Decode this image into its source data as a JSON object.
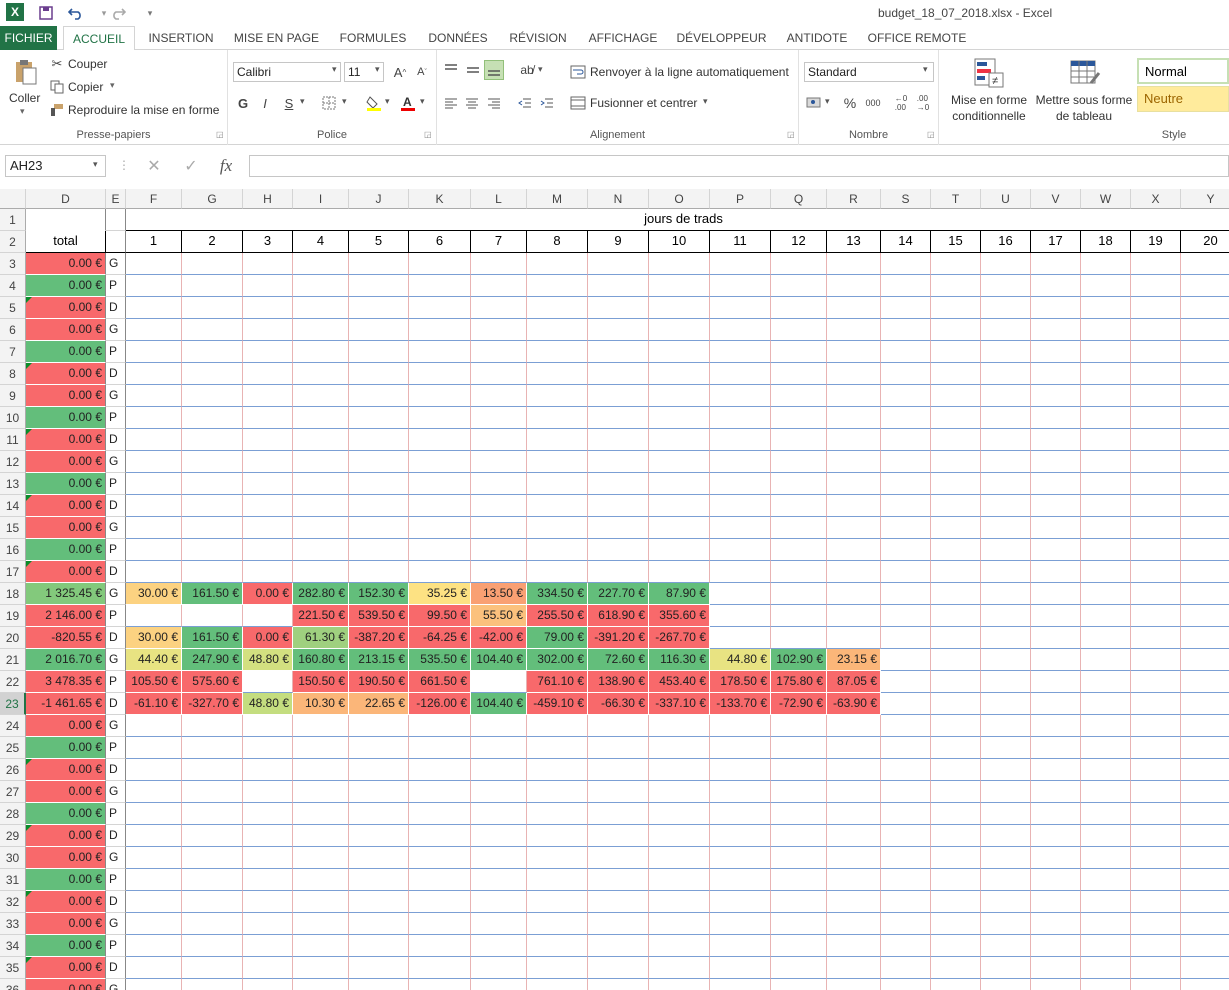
{
  "titlebar": {
    "title": "budget_18_07_2018.xlsx - Excel",
    "app_icon": "X",
    "save_icon": "save-icon",
    "undo_icon": "undo-icon",
    "redo_icon": "redo-icon"
  },
  "tabs": [
    "FICHIER",
    "ACCUEIL",
    "INSERTION",
    "MISE EN PAGE",
    "FORMULES",
    "DONNÉES",
    "RÉVISION",
    "AFFICHAGE",
    "DÉVELOPPEUR",
    "ANTIDOTE",
    "OFFICE REMOTE"
  ],
  "ribbon": {
    "clipboard": {
      "paste": "Coller",
      "cut": "Couper",
      "copy": "Copier",
      "format_painter": "Reproduire la mise en forme",
      "label": "Presse-papiers"
    },
    "font": {
      "name": "Calibri",
      "size": "11",
      "bold": "G",
      "italic": "I",
      "underline": "S",
      "label": "Police"
    },
    "alignment": {
      "wrap": "Renvoyer à la ligne automatiquement",
      "merge": "Fusionner et centrer",
      "label": "Alignement"
    },
    "number": {
      "format": "Standard",
      "percent": "%",
      "thousands": "000",
      "label": "Nombre"
    },
    "styles": {
      "conditional": "Mise en forme conditionnelle",
      "table": "Mettre sous forme de tableau",
      "normal": "Normal",
      "neutral": "Neutre",
      "label": "Style"
    }
  },
  "formula_bar": {
    "name_box": "AH23",
    "fx": "fx",
    "value": ""
  },
  "columns": [
    "D",
    "E",
    "F",
    "G",
    "H",
    "I",
    "J",
    "K",
    "L",
    "M",
    "N",
    "O",
    "P",
    "Q",
    "R",
    "S",
    "T",
    "U",
    "V",
    "W",
    "X",
    "Y"
  ],
  "header": {
    "group_title": "jours de trads",
    "total": "total",
    "days": [
      "1",
      "2",
      "3",
      "4",
      "5",
      "6",
      "7",
      "8",
      "9",
      "10",
      "11",
      "12",
      "13",
      "14",
      "15",
      "16",
      "17",
      "18",
      "19",
      "20"
    ]
  },
  "colors": {
    "red": "#f8696b",
    "green": "#63be7b",
    "accent": "#217346"
  },
  "rows": [
    {
      "n": "3",
      "total": "0.00 €",
      "tc": "red",
      "type": "G",
      "tri": false,
      "cells": []
    },
    {
      "n": "4",
      "total": "0.00 €",
      "tc": "green",
      "type": "P",
      "tri": false,
      "cells": []
    },
    {
      "n": "5",
      "total": "0.00 €",
      "tc": "red",
      "type": "D",
      "tri": true,
      "cells": []
    },
    {
      "n": "6",
      "total": "0.00 €",
      "tc": "red",
      "type": "G",
      "tri": false,
      "cells": []
    },
    {
      "n": "7",
      "total": "0.00 €",
      "tc": "green",
      "type": "P",
      "tri": false,
      "cells": []
    },
    {
      "n": "8",
      "total": "0.00 €",
      "tc": "red",
      "type": "D",
      "tri": true,
      "cells": []
    },
    {
      "n": "9",
      "total": "0.00 €",
      "tc": "red",
      "type": "G",
      "tri": false,
      "cells": []
    },
    {
      "n": "10",
      "total": "0.00 €",
      "tc": "green",
      "type": "P",
      "tri": false,
      "cells": []
    },
    {
      "n": "11",
      "total": "0.00 €",
      "tc": "red",
      "type": "D",
      "tri": true,
      "cells": []
    },
    {
      "n": "12",
      "total": "0.00 €",
      "tc": "red",
      "type": "G",
      "tri": false,
      "cells": []
    },
    {
      "n": "13",
      "total": "0.00 €",
      "tc": "green",
      "type": "P",
      "tri": false,
      "cells": []
    },
    {
      "n": "14",
      "total": "0.00 €",
      "tc": "red",
      "type": "D",
      "tri": true,
      "cells": []
    },
    {
      "n": "15",
      "total": "0.00 €",
      "tc": "red",
      "type": "G",
      "tri": false,
      "cells": []
    },
    {
      "n": "16",
      "total": "0.00 €",
      "tc": "green",
      "type": "P",
      "tri": false,
      "cells": []
    },
    {
      "n": "17",
      "total": "0.00 €",
      "tc": "red",
      "type": "D",
      "tri": true,
      "cells": []
    },
    {
      "n": "18",
      "total": "1 325.45 €",
      "tc": "#83c97c",
      "type": "G",
      "tri": false,
      "cells": [
        [
          "30.00 €",
          "#fcd281"
        ],
        [
          "161.50 €",
          "#63be7b"
        ],
        [
          "0.00 €",
          "#f8696b"
        ],
        [
          "282.80 €",
          "#63be7b"
        ],
        [
          "152.30 €",
          "#63be7b"
        ],
        [
          "35.25 €",
          "#fde283"
        ],
        [
          "13.50 €",
          "#f9a073"
        ],
        [
          "334.50 €",
          "#63be7b"
        ],
        [
          "227.70 €",
          "#63be7b"
        ],
        [
          "87.90 €",
          "#63be7b"
        ]
      ]
    },
    {
      "n": "19",
      "total": "2 146.00 €",
      "tc": "red",
      "type": "P",
      "tri": false,
      "cells": [
        [
          "",
          ""
        ],
        [
          "",
          ""
        ],
        [
          "",
          ""
        ],
        [
          "221.50 €",
          "#f8696b"
        ],
        [
          "539.50 €",
          "#f8696b"
        ],
        [
          "99.50 €",
          "#f8696b"
        ],
        [
          "55.50 €",
          "#fbc17d"
        ],
        [
          "255.50 €",
          "#f8696b"
        ],
        [
          "618.90 €",
          "#f8696b"
        ],
        [
          "355.60 €",
          "#f8696b"
        ]
      ]
    },
    {
      "n": "20",
      "total": "-820.55 €",
      "tc": "red",
      "type": "D",
      "tri": false,
      "cells": [
        [
          "30.00 €",
          "#fcd281"
        ],
        [
          "161.50 €",
          "#63be7b"
        ],
        [
          "0.00 €",
          "#f8696b"
        ],
        [
          "61.30 €",
          "#9fd07f"
        ],
        [
          "-387.20 €",
          "#f8696b"
        ],
        [
          "-64.25 €",
          "#f8696b"
        ],
        [
          "-42.00 €",
          "#f8696b"
        ],
        [
          "79.00 €",
          "#63be7b"
        ],
        [
          "-391.20 €",
          "#f8696b"
        ],
        [
          "-267.70 €",
          "#f8696b"
        ]
      ]
    },
    {
      "n": "21",
      "total": "2 016.70 €",
      "tc": "green",
      "type": "G",
      "tri": false,
      "cells": [
        [
          "44.40 €",
          "#e8e382"
        ],
        [
          "247.90 €",
          "#63be7b"
        ],
        [
          "48.80 €",
          "#d3e080"
        ],
        [
          "160.80 €",
          "#63be7b"
        ],
        [
          "213.15 €",
          "#63be7b"
        ],
        [
          "535.50 €",
          "#63be7b"
        ],
        [
          "104.40 €",
          "#63be7b"
        ],
        [
          "302.00 €",
          "#63be7b"
        ],
        [
          "72.60 €",
          "#63be7b"
        ],
        [
          "116.30 €",
          "#63be7b"
        ],
        [
          "44.80 €",
          "#e8e382"
        ],
        [
          "102.90 €",
          "#63be7b"
        ],
        [
          "23.15 €",
          "#fbb679"
        ]
      ]
    },
    {
      "n": "22",
      "total": "3 478.35 €",
      "tc": "red",
      "type": "P",
      "tri": false,
      "cells": [
        [
          "105.50 €",
          "#f8696b"
        ],
        [
          "575.60 €",
          "#f8696b"
        ],
        [
          "",
          ""
        ],
        [
          "150.50 €",
          "#f8696b"
        ],
        [
          "190.50 €",
          "#f8696b"
        ],
        [
          "661.50 €",
          "#f8696b"
        ],
        [
          "",
          ""
        ],
        [
          "761.10 €",
          "#f8696b"
        ],
        [
          "138.90 €",
          "#f8696b"
        ],
        [
          "453.40 €",
          "#f8696b"
        ],
        [
          "178.50 €",
          "#f8696b"
        ],
        [
          "175.80 €",
          "#f8696b"
        ],
        [
          "87.05 €",
          "#f8696b"
        ]
      ]
    },
    {
      "n": "23",
      "total": "-1 461.65 €",
      "tc": "red",
      "type": "D",
      "tri": false,
      "cells": [
        [
          "-61.10 €",
          "#f8696b"
        ],
        [
          "-327.70 €",
          "#f8696b"
        ],
        [
          "48.80 €",
          "#c4dd7f"
        ],
        [
          "10.30 €",
          "#fbb679"
        ],
        [
          "22.65 €",
          "#fbb679"
        ],
        [
          "-126.00 €",
          "#f8696b"
        ],
        [
          "104.40 €",
          "#63be7b"
        ],
        [
          "-459.10 €",
          "#f8696b"
        ],
        [
          "-66.30 €",
          "#f8696b"
        ],
        [
          "-337.10 €",
          "#f8696b"
        ],
        [
          "-133.70 €",
          "#f8696b"
        ],
        [
          "-72.90 €",
          "#f8696b"
        ],
        [
          "-63.90 €",
          "#f8696b"
        ]
      ]
    },
    {
      "n": "24",
      "total": "0.00 €",
      "tc": "red",
      "type": "G",
      "tri": false,
      "cells": []
    },
    {
      "n": "25",
      "total": "0.00 €",
      "tc": "green",
      "type": "P",
      "tri": false,
      "cells": []
    },
    {
      "n": "26",
      "total": "0.00 €",
      "tc": "red",
      "type": "D",
      "tri": true,
      "cells": []
    },
    {
      "n": "27",
      "total": "0.00 €",
      "tc": "red",
      "type": "G",
      "tri": false,
      "cells": []
    },
    {
      "n": "28",
      "total": "0.00 €",
      "tc": "green",
      "type": "P",
      "tri": false,
      "cells": []
    },
    {
      "n": "29",
      "total": "0.00 €",
      "tc": "red",
      "type": "D",
      "tri": true,
      "cells": []
    },
    {
      "n": "30",
      "total": "0.00 €",
      "tc": "red",
      "type": "G",
      "tri": false,
      "cells": []
    },
    {
      "n": "31",
      "total": "0.00 €",
      "tc": "green",
      "type": "P",
      "tri": false,
      "cells": []
    },
    {
      "n": "32",
      "total": "0.00 €",
      "tc": "red",
      "type": "D",
      "tri": true,
      "cells": []
    },
    {
      "n": "33",
      "total": "0.00 €",
      "tc": "red",
      "type": "G",
      "tri": false,
      "cells": []
    },
    {
      "n": "34",
      "total": "0.00 €",
      "tc": "green",
      "type": "P",
      "tri": false,
      "cells": []
    },
    {
      "n": "35",
      "total": "0.00 €",
      "tc": "red",
      "type": "D",
      "tri": true,
      "cells": []
    },
    {
      "n": "36",
      "total": "0.00 €",
      "tc": "red",
      "type": "G",
      "tri": false,
      "cells": []
    }
  ],
  "selected_row": "23"
}
